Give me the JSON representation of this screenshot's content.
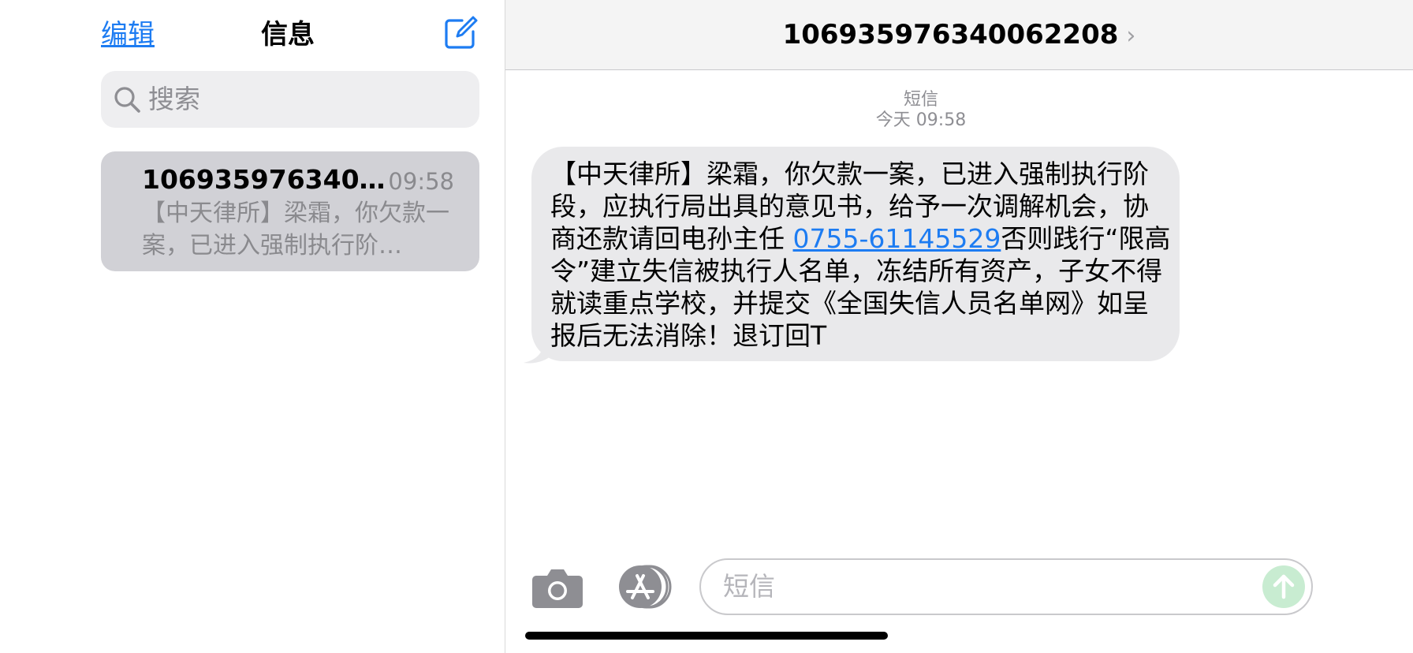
{
  "sidebar": {
    "edit_label": "编辑",
    "title": "信息",
    "search_placeholder": "搜索",
    "conversations": [
      {
        "name": "1069359763400...",
        "time": "09:58",
        "preview": "【中天律所】梁霜，你欠款一案，已进入强制执行阶…"
      }
    ]
  },
  "chat": {
    "header_title": "106935976340062208",
    "header_chevron": "›",
    "meta_label": "短信",
    "meta_time": "今天 09:58",
    "message": {
      "text_before": "【中天律所】梁霜，你欠款一案，已进入强制执行阶段，应执行局出具的意见书，给予一次调解机会，协商还款请回电孙主任 ",
      "phone": "0755-61145529",
      "text_after": "否则践行“限高令”建立失信被执行人名单，冻结所有资产，子女不得就读重点学校，并提交《全国失信人员名单网》如呈报后无法消除！退订回T"
    },
    "input_placeholder": "短信"
  },
  "colors": {
    "accent": "#1d7cf2",
    "bubble": "#e9e9eb",
    "selected_row": "#d1d1d6",
    "send_button": "#c8ecd1"
  },
  "icons": {
    "compose": "compose-icon",
    "search": "search-icon",
    "camera": "camera-icon",
    "appstore": "app-store-icon",
    "send": "send-arrow-icon"
  }
}
